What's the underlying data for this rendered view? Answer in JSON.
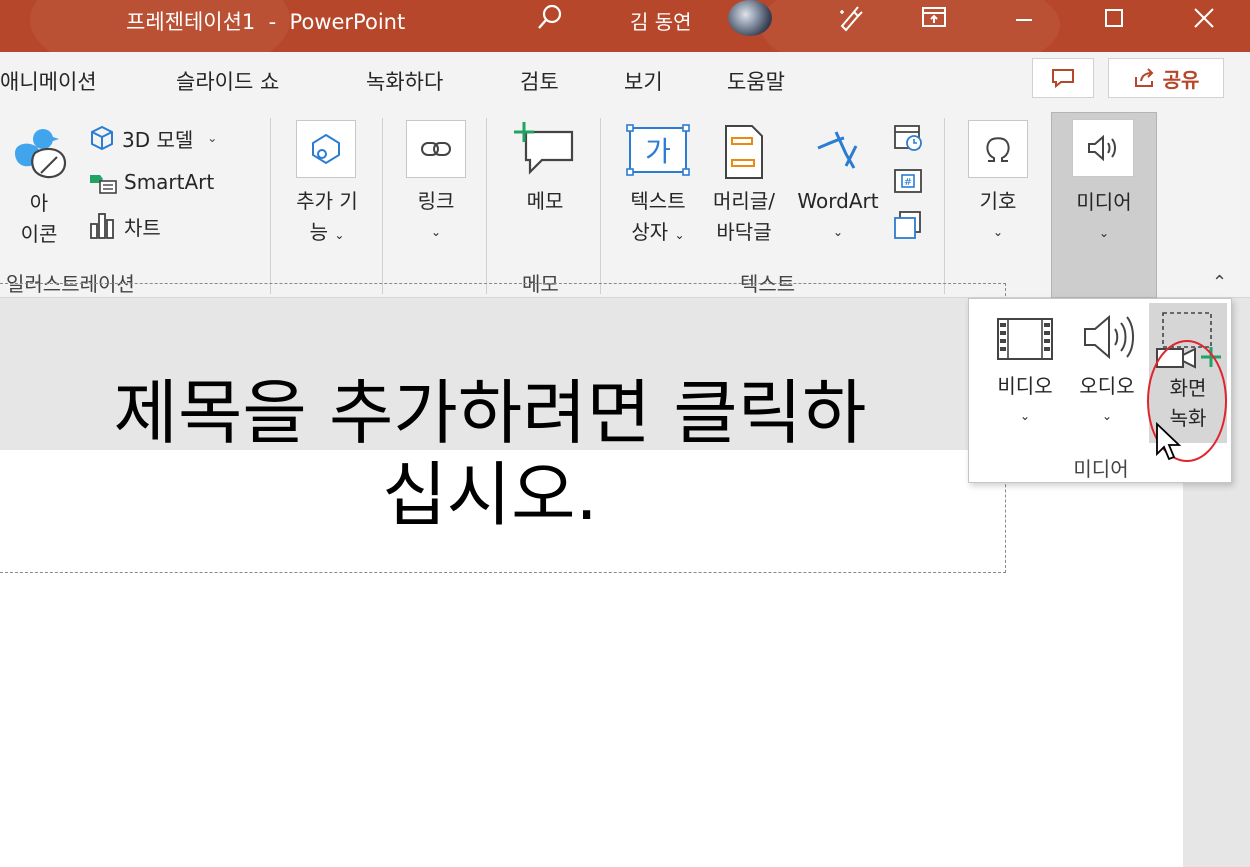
{
  "titlebar": {
    "title": "프레젠테이션1  -  PowerPoint",
    "user_name": "김 동연",
    "icons": [
      "search-icon",
      "avatar",
      "pen-icon",
      "ribbon-display-icon",
      "minimize-icon",
      "maximize-icon",
      "close-icon"
    ],
    "bg_color": "#b7472a"
  },
  "tabs": {
    "items": [
      "애니메이션",
      "슬라이드 쇼",
      "녹화하다",
      "검토",
      "보기",
      "도움말"
    ],
    "share_label": "공유"
  },
  "ribbon": {
    "illustrations": {
      "icons_label_line1": "아",
      "icons_label_line2": "이콘",
      "model3d_label": "3D 모델",
      "smartart_label": "SmartArt",
      "chart_label": "차트",
      "group_label": "일러스트레이션"
    },
    "addins": {
      "label_line1": "추가 기",
      "label_line2": "능"
    },
    "links": {
      "label": "링크"
    },
    "comments": {
      "label": "메모",
      "group_label": "메모"
    },
    "text": {
      "textbox_line1": "텍스트",
      "textbox_line2": "상자",
      "header_line1": "머리글/",
      "header_line2": "바닥글",
      "wordart_label": "WordArt",
      "group_label": "텍스트"
    },
    "symbols": {
      "label": "기호"
    },
    "media": {
      "label": "미디어"
    }
  },
  "media_dropdown": {
    "video_label": "비디오",
    "audio_label": "오디오",
    "screen_record_line1": "화면",
    "screen_record_line2": "녹화",
    "group_label": "미디어",
    "highlight_color": "#e0242d"
  },
  "slide": {
    "title_placeholder": "제목을 추가하려면 클릭하\n십시오."
  }
}
